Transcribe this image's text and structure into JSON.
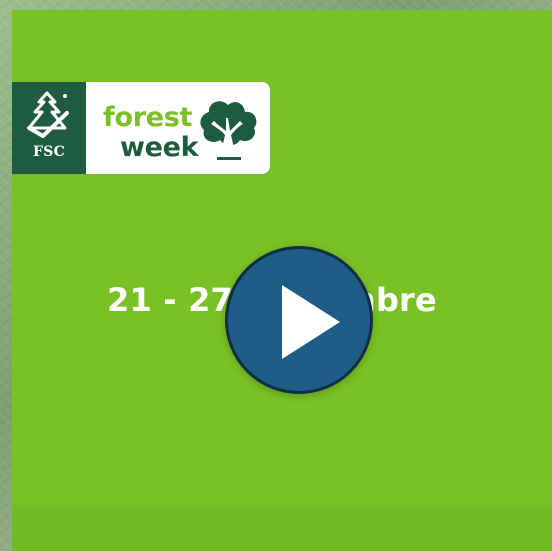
{
  "brand": {
    "fsc_label": "FSC",
    "forest_word": "forest",
    "week_word": "week"
  },
  "event": {
    "dates_text": "21 - 27 Settembre"
  },
  "video": {
    "play_icon": "play-icon"
  },
  "colors": {
    "accent_green": "#7ac125",
    "dark_green": "#1f5b41",
    "play_blue": "#1e5d86"
  }
}
